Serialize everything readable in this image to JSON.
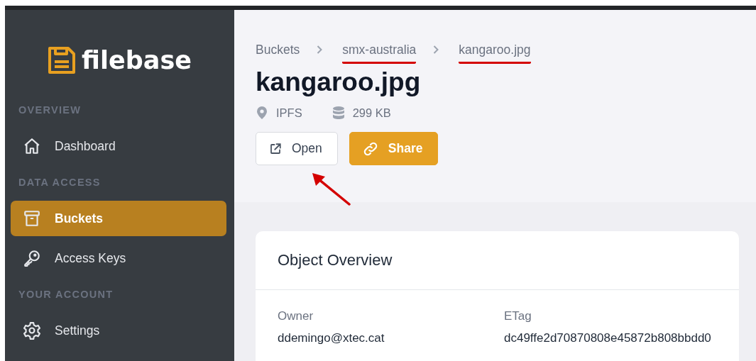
{
  "sidebar": {
    "logo": "filebase",
    "sections": [
      {
        "label": "OVERVIEW",
        "items": [
          {
            "label": "Dashboard",
            "kind": "home",
            "selected": false
          }
        ]
      },
      {
        "label": "DATA ACCESS",
        "items": [
          {
            "label": "Buckets",
            "kind": "archive",
            "selected": true
          },
          {
            "label": "Access Keys",
            "kind": "key",
            "selected": false
          }
        ]
      },
      {
        "label": "YOUR ACCOUNT",
        "items": [
          {
            "label": "Settings",
            "kind": "gear",
            "selected": false
          }
        ]
      }
    ]
  },
  "breadcrumb": [
    {
      "label": "Buckets",
      "underlined": false
    },
    {
      "label": "smx-australia",
      "underlined": true
    },
    {
      "label": "kangaroo.jpg",
      "underlined": true
    }
  ],
  "title": "kangaroo.jpg",
  "meta": [
    {
      "kind": "pin",
      "text": "IPFS"
    },
    {
      "kind": "database",
      "text": "299 KB"
    }
  ],
  "buttons": [
    {
      "label": "Open",
      "kind": "secondary",
      "pointed_at": true
    },
    {
      "label": "Share",
      "kind": "primary",
      "pointed_at": false
    }
  ],
  "card": {
    "title": "Object Overview",
    "fields": [
      {
        "label": "Owner",
        "value": "ddemingo@xtec.cat"
      },
      {
        "label": "ETag",
        "value": "dc49ffe2d70870808e45872b808bbdd0"
      }
    ]
  }
}
